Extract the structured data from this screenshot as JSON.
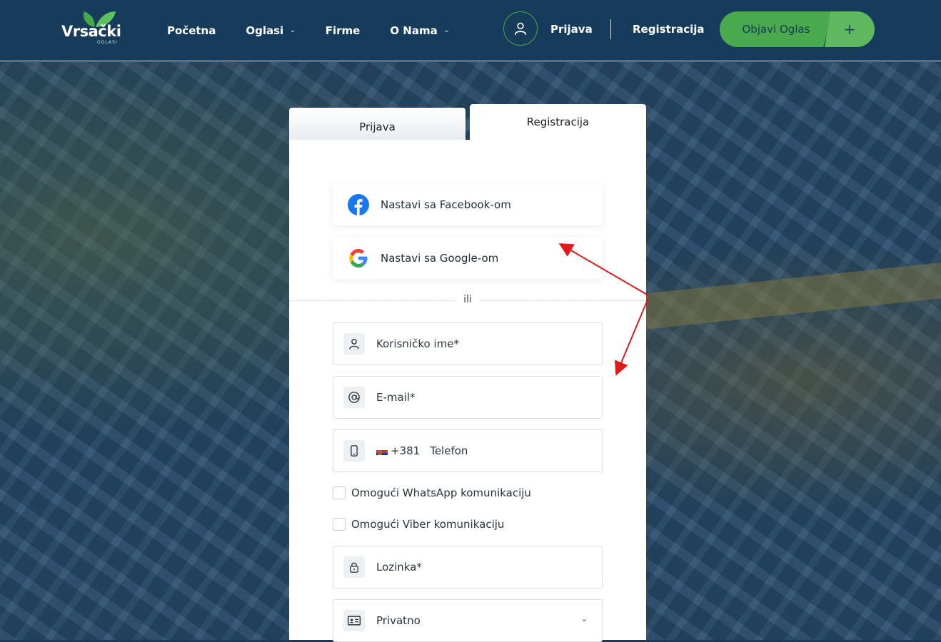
{
  "brand": {
    "logo_text": "Vrsački",
    "logo_sub": "OGLASI",
    "leaf_color": "#45a84a"
  },
  "nav": {
    "items": [
      {
        "label": "Početna",
        "has_dropdown": false
      },
      {
        "label": "Oglasi",
        "has_dropdown": true
      },
      {
        "label": "Firme",
        "has_dropdown": false
      },
      {
        "label": "O Nama",
        "has_dropdown": true
      }
    ],
    "caret": "⌄"
  },
  "header": {
    "login_label": "Prijava",
    "register_label": "Registracija",
    "post_ad_label": "Objavi Oglas",
    "post_ad_plus": "+",
    "bg_color": "#163b5b",
    "accent_green": "#4aa94d"
  },
  "tabs": {
    "login": "Prijava",
    "register": "Registracija",
    "active": "register"
  },
  "social": {
    "facebook_label": "Nastavi sa Facebook-om",
    "google_label": "Nastavi sa Google-om"
  },
  "separator": "ili",
  "form": {
    "username_placeholder": "Korisničko ime*",
    "email_placeholder": "E-mail*",
    "phone_code": "+381",
    "phone_placeholder": "Telefon",
    "whatsapp_label": "Omogući WhatsApp komunikaciju",
    "viber_label": "Omogući Viber komunikaciju",
    "password_placeholder": "Lozinka*",
    "account_type_value": "Privatno",
    "chevron": "⌄"
  },
  "icons": {
    "user": "user-icon",
    "at": "at-sign-icon",
    "phone": "mobile-phone-icon",
    "lock": "lock-icon",
    "id_card": "id-card-icon",
    "facebook": "facebook-icon",
    "google": "google-icon",
    "serbia_flag": "serbia-flag-icon"
  },
  "annotation": {
    "arrow_color": "#e0191b"
  }
}
